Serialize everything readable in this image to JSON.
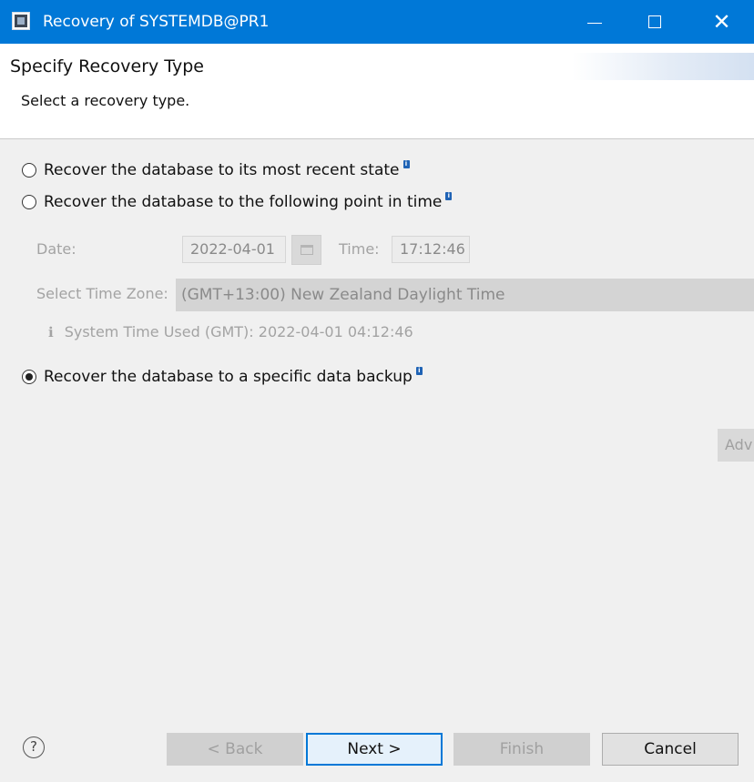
{
  "window": {
    "title": "Recovery of SYSTEMDB@PR1",
    "controls": {
      "minimize": "minimize",
      "maximize": "maximize",
      "close": "✕"
    }
  },
  "header": {
    "title": "Specify Recovery Type",
    "description": "Select a recovery type."
  },
  "options": [
    {
      "label": "Recover the database to its most recent state",
      "selected": false,
      "info": "i"
    },
    {
      "label": "Recover the database to the following point in time",
      "selected": false,
      "info": "i"
    },
    {
      "label": "Recover the database to a specific data backup",
      "selected": true,
      "info": "i"
    }
  ],
  "point_in_time": {
    "date_label": "Date:",
    "date_value": "2022-04-01",
    "time_label": "Time:",
    "time_value": "17:12:46",
    "timezone_label": "Select Time Zone:",
    "timezone_value": "(GMT+13:00) New Zealand Daylight Time",
    "system_time_icon": "ℹ",
    "system_time_text": "System Time Used (GMT): 2022-04-01 04:12:46"
  },
  "advanced_button": "Adv",
  "footer": {
    "help": "?",
    "back": "< Back",
    "next": "Next >",
    "finish": "Finish",
    "cancel": "Cancel"
  },
  "colors": {
    "titlebar": "#0078d7",
    "dialog_bg": "#f0f0f0",
    "banner_bg": "#ffffff",
    "info_badge": "#1f63b5"
  }
}
